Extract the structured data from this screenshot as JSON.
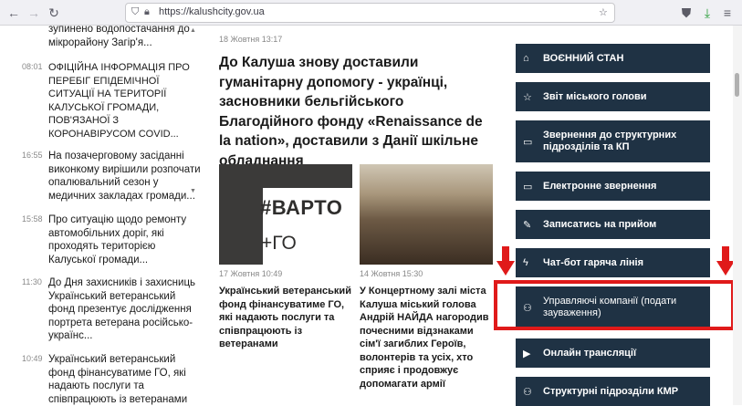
{
  "browser": {
    "url": "https://kalushcity.gov.ua",
    "back_icon": "←",
    "forward_icon": "→",
    "reload_icon": "↻"
  },
  "left_news": [
    {
      "time": "",
      "text": "зупинено водопостачання до мікрорайону Загір'я..."
    },
    {
      "time": "08:01",
      "text": "ОФІЦІЙНА ІНФОРМАЦІЯ ПРО ПЕРЕБІГ ЕПІДЕМІЧНОЇ СИТУАЦІЇ НА ТЕРИТОРІЇ КАЛУСЬКОЇ ГРОМАДИ, ПОВ'ЯЗАНОЇ З КОРОНАВІРУСОМ COVID..."
    },
    {
      "time": "16:55",
      "text": "На позачерговому засіданні виконкому вирішили розпочати опалювальний сезон у медичних закладах громади..."
    },
    {
      "time": "15:58",
      "text": "Про ситуацію щодо ремонту автомобільних доріг, які проходять територією Калуської громади..."
    },
    {
      "time": "11:30",
      "text": "До Дня захисників і захисниць Український ветеранський фонд презентує дослідження портрета ветерана російсько-українс..."
    },
    {
      "time": "10:49",
      "text": "Український ветеранський фонд фінансуватиме ГО, які надають послуги та співпрацюють із ветеранами"
    }
  ],
  "main_story": {
    "date": "18 Жовтня 13:17",
    "headline": "До Калуша знову доставили гуманітарну допомогу - українці, засновники бельгійського Благодійного фонду «Renaissance de la nation», доставили з Данії шкільне обладнання"
  },
  "cards": [
    {
      "image_text_1": "#ВАРТО",
      "image_text_2": "+ГО",
      "date": "17 Жовтня 10:49",
      "title": "Український ветеранський фонд фінансуватиме ГО, які надають послуги та співпрацюють із ветеранами"
    },
    {
      "date": "14 Жовтня 15:30",
      "title": "У Концертному залі міста Калуша міський голова Андрій НАЙДА нагородив почесними відзнаками сім'ї загиблих Героїв, волонтерів та усіх, хто сприяє і продовжує допомагати армії"
    }
  ],
  "menu": [
    {
      "icon": "home-icon",
      "glyph": "⌂",
      "label": "ВОЄННИЙ СТАН"
    },
    {
      "icon": "star-icon",
      "glyph": "☆",
      "label": "Звіт міського голови"
    },
    {
      "icon": "chat-icon",
      "glyph": "▭",
      "label": "Звернення до структурних підрозділів та КП"
    },
    {
      "icon": "message-icon",
      "glyph": "▭",
      "label": "Електронне звернення"
    },
    {
      "icon": "edit-icon",
      "glyph": "✎",
      "label": "Записатись на прийом"
    },
    {
      "icon": "bolt-icon",
      "glyph": "ϟ",
      "label": "Чат-бот гаряча лінія"
    },
    {
      "icon": "sitemap-icon",
      "glyph": "⚇",
      "label": "Управляючі компанії (подати зауваження)"
    },
    {
      "icon": "video-icon",
      "glyph": "▶",
      "label": "Онлайн трансляції"
    },
    {
      "icon": "sitemap-icon",
      "glyph": "⚇",
      "label": "Структурні підрозділи КМР"
    }
  ],
  "colors": {
    "menu_bg": "#1f3244",
    "highlight": "#e01a1a"
  }
}
